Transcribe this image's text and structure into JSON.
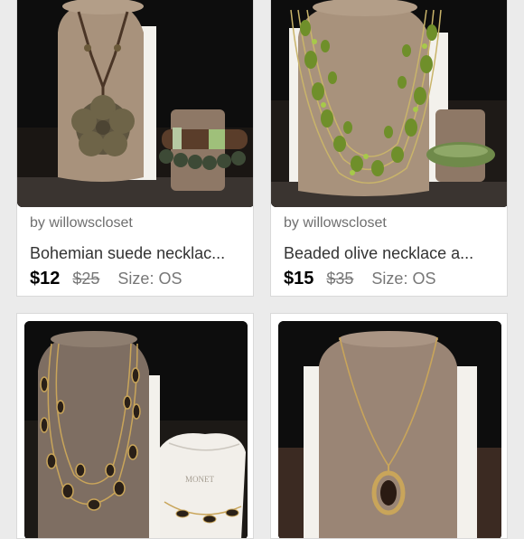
{
  "listings": [
    {
      "seller": "by willowscloset",
      "title": "Bohemian suede necklac...",
      "price": "$12",
      "original_price": "$25",
      "size": "Size: OS",
      "image_icon": "necklace-photo"
    },
    {
      "seller": "by willowscloset",
      "title": "Beaded olive necklace a...",
      "price": "$15",
      "original_price": "$35",
      "size": "Size: OS",
      "image_icon": "necklace-photo"
    },
    {
      "seller": "",
      "title": "",
      "price": "",
      "original_price": "",
      "size": "",
      "image_icon": "necklace-photo"
    },
    {
      "seller": "",
      "title": "",
      "price": "",
      "original_price": "",
      "size": "",
      "image_icon": "necklace-photo"
    }
  ],
  "bag_brand": "MONET",
  "colors": {
    "page_bg": "#ebebeb",
    "card_bg": "#ffffff",
    "bust": "#a8927c",
    "olive": "#6f8f2a",
    "gold": "#c9a55a"
  }
}
